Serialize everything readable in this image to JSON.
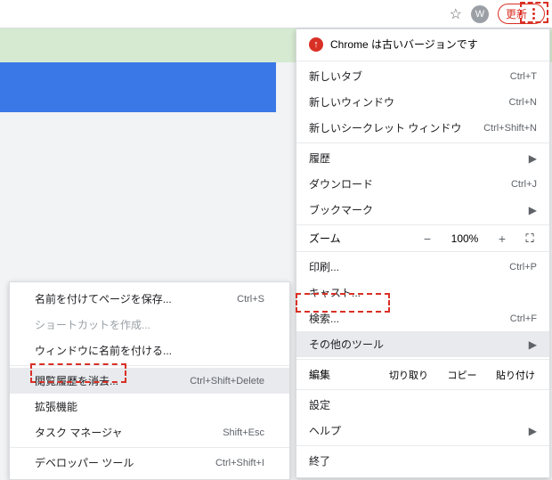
{
  "toolbar": {
    "avatar_letter": "W",
    "update_label": "更新"
  },
  "status": {
    "text": "Chrome は古いバージョンです"
  },
  "menu": {
    "new_tab": "新しいタブ",
    "new_tab_sc": "Ctrl+T",
    "new_window": "新しいウィンドウ",
    "new_window_sc": "Ctrl+N",
    "new_incognito": "新しいシークレット ウィンドウ",
    "new_incognito_sc": "Ctrl+Shift+N",
    "history": "履歴",
    "downloads": "ダウンロード",
    "downloads_sc": "Ctrl+J",
    "bookmarks": "ブックマーク",
    "zoom_label": "ズーム",
    "zoom_pct": "100%",
    "print": "印刷...",
    "print_sc": "Ctrl+P",
    "cast": "キャスト...",
    "find": "検索...",
    "find_sc": "Ctrl+F",
    "more_tools": "その他のツール",
    "edit_label": "編集",
    "cut": "切り取り",
    "copy": "コピー",
    "paste": "貼り付け",
    "settings": "設定",
    "help": "ヘルプ",
    "exit": "終了"
  },
  "sub": {
    "save_page": "名前を付けてページを保存...",
    "save_page_sc": "Ctrl+S",
    "create_shortcut": "ショートカットを作成...",
    "name_window": "ウィンドウに名前を付ける...",
    "clear_browsing": "閲覧履歴を消去...",
    "clear_browsing_sc": "Ctrl+Shift+Delete",
    "extensions": "拡張機能",
    "task_manager": "タスク マネージャ",
    "task_manager_sc": "Shift+Esc",
    "dev_tools": "デベロッパー ツール",
    "dev_tools_sc": "Ctrl+Shift+I"
  }
}
